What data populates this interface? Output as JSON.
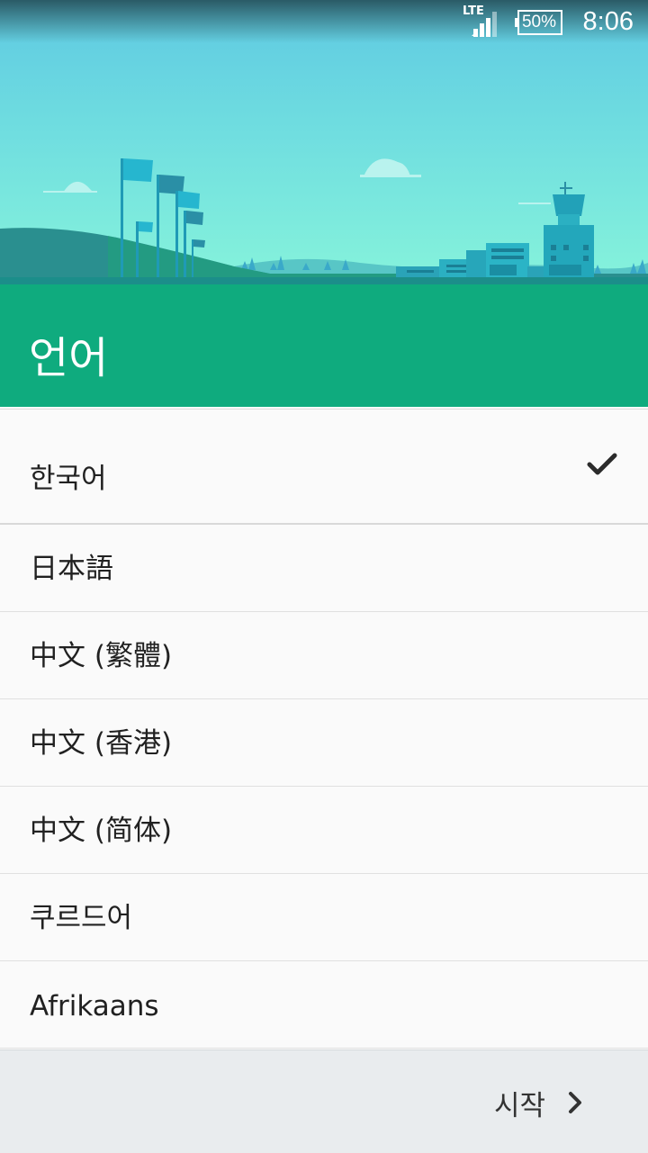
{
  "status_bar": {
    "network": "LTE",
    "battery": "50%",
    "time": "8:06",
    "icons": [
      "signal-icon",
      "battery-icon"
    ]
  },
  "header": {
    "title": "언어"
  },
  "languages": [
    {
      "label": "한국어",
      "selected": true
    },
    {
      "label": "日本語",
      "selected": false
    },
    {
      "label": "中文 (繁體)",
      "selected": false
    },
    {
      "label": "中文 (香港)",
      "selected": false
    },
    {
      "label": "中文 (简体)",
      "selected": false
    },
    {
      "label": "쿠르드어",
      "selected": false
    },
    {
      "label": "Afrikaans",
      "selected": false
    }
  ],
  "footer": {
    "start_label": "시작",
    "icon": "chevron-right-icon"
  },
  "colors": {
    "accent": "#0fab7e",
    "sky_top": "#5ec9e2",
    "sky_bottom": "#86f3db",
    "footer_bg": "#e9ecee"
  }
}
